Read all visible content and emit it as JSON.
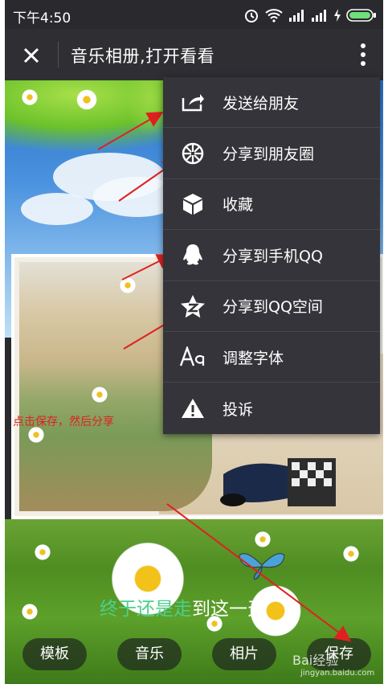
{
  "status_bar": {
    "time": "下午4:50"
  },
  "title_bar": {
    "title": "音乐相册,打开看看"
  },
  "menu": {
    "items": [
      {
        "label": "发送给朋友",
        "icon": "share-forward-icon"
      },
      {
        "label": "分享到朋友圈",
        "icon": "moments-aperture-icon"
      },
      {
        "label": "收藏",
        "icon": "favorite-cube-icon"
      },
      {
        "label": "分享到手机QQ",
        "icon": "qq-penguin-icon"
      },
      {
        "label": "分享到QQ空间",
        "icon": "qzone-star-icon"
      },
      {
        "label": "调整字体",
        "icon": "font-aa-icon"
      },
      {
        "label": "投诉",
        "icon": "warning-icon"
      }
    ]
  },
  "content": {
    "caption_green": "终于还是走",
    "caption_rest": "到这一天",
    "annotation": "点击保存，然后分享"
  },
  "bottom_buttons": {
    "template": "模板",
    "music": "音乐",
    "photos": "相片",
    "save": "保存"
  },
  "watermark": {
    "brand": "Bai经验",
    "url": "jingyan.baidu.com"
  },
  "colors": {
    "annotation": "#e02020",
    "caption_green": "#4ad08a",
    "menu_bg": "#34343a",
    "titlebar_bg": "#2f2f33"
  }
}
